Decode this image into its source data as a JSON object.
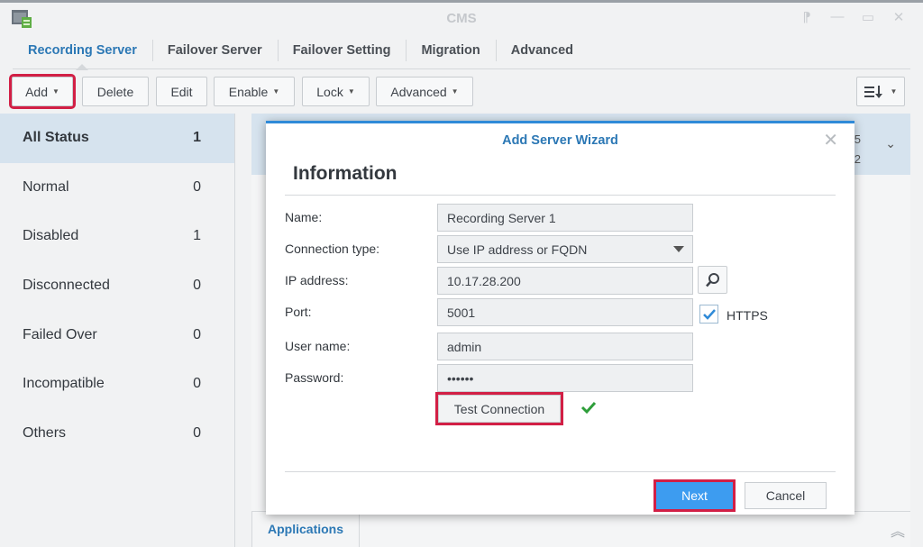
{
  "window": {
    "title": "CMS"
  },
  "tabs": [
    {
      "label": "Recording Server"
    },
    {
      "label": "Failover Server"
    },
    {
      "label": "Failover Setting"
    },
    {
      "label": "Migration"
    },
    {
      "label": "Advanced"
    }
  ],
  "toolbar": {
    "add": "Add",
    "delete": "Delete",
    "edit": "Edit",
    "enable": "Enable",
    "lock": "Lock",
    "advanced": "Advanced"
  },
  "sidebar": {
    "items": [
      {
        "label": "All Status",
        "count": "1"
      },
      {
        "label": "Normal",
        "count": "0"
      },
      {
        "label": "Disabled",
        "count": "1"
      },
      {
        "label": "Disconnected",
        "count": "0"
      },
      {
        "label": "Failed Over",
        "count": "0"
      },
      {
        "label": "Incompatible",
        "count": "0"
      },
      {
        "label": "Others",
        "count": "0"
      }
    ]
  },
  "main": {
    "row_values": [
      "5",
      "2"
    ],
    "bottom_tab": "Applications"
  },
  "dialog": {
    "title": "Add Server Wizard",
    "heading": "Information",
    "fields": {
      "name": {
        "label": "Name:",
        "value": "Recording Server 1"
      },
      "connection_type": {
        "label": "Connection type:",
        "value": "Use IP address or FQDN"
      },
      "ip": {
        "label": "IP address:",
        "value": "10.17.28.200"
      },
      "port": {
        "label": "Port:",
        "value": "5001"
      },
      "https": {
        "label": "HTTPS",
        "checked": true
      },
      "username": {
        "label": "User name:",
        "value": "admin"
      },
      "password": {
        "label": "Password:",
        "value": "••••••"
      }
    },
    "test_connection": "Test Connection",
    "next": "Next",
    "cancel": "Cancel"
  },
  "colors": {
    "accent": "#2c78b5",
    "primary_button": "#3d9cf0",
    "highlight": "#d21f45",
    "success": "#2e9e3a"
  }
}
